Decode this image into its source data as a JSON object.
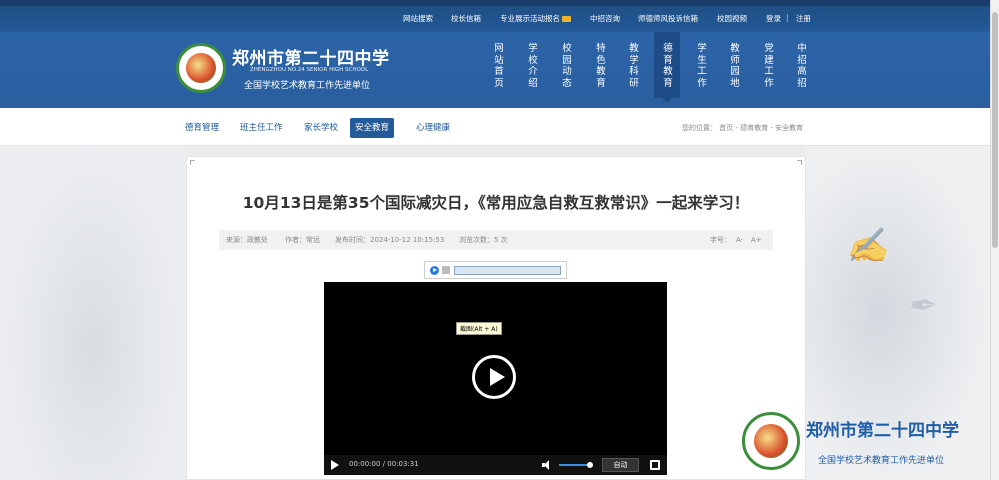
{
  "colors": {
    "brand_blue": "#245a97",
    "header_blue": "#2c64a8",
    "link_blue": "#1f5a9c",
    "logo_green": "#3b8f3a"
  },
  "topbar": {
    "links": [
      "网站搜索",
      "校长信箱",
      "专业展示活动报名",
      "中招咨询",
      "师德师风投诉信箱",
      "校园视频"
    ],
    "login": "登录",
    "divider": "|",
    "register": "注册"
  },
  "header": {
    "school_name": "郑州市第二十四中学",
    "school_name_en": "ZHENGZHOU NO.24 SENIOR HIGH SCHOOL",
    "honor": "全国学校艺术教育工作先进单位",
    "nav": [
      "网站首页",
      "学校介绍",
      "校园动态",
      "特色教育",
      "教学科研",
      "德育教育",
      "学生工作",
      "教师园地",
      "党建工作",
      "中招高招"
    ],
    "nav_active_index": 5
  },
  "subnav": {
    "items": [
      "德育管理",
      "班主任工作",
      "家长学校",
      "安全教育",
      "心理健康"
    ],
    "active_index": 3,
    "breadcrumb": "您的位置： 首页 - 德育教育 - 安全教育"
  },
  "article": {
    "title": "10月13日是第35个国际减灾日，《常用应急自救互救常识》一起来学习！",
    "meta": {
      "source": "来源：政教处",
      "author": "作者：常远",
      "publish_time": "发布时间：2024-10-12 10:15:53",
      "views": "浏览次数：5 次",
      "font_size_label": "字号：",
      "font_smaller": "A-",
      "font_larger": "A+"
    }
  },
  "video": {
    "tooltip": "截图(Alt + A)",
    "time": "00:00:00 / 00:03:31",
    "auto_label": "自动",
    "volume_level": 0.8
  },
  "floating_brand": {
    "name": "郑州市第二十四中学",
    "honor": "全国学校艺术教育工作先进单位"
  }
}
